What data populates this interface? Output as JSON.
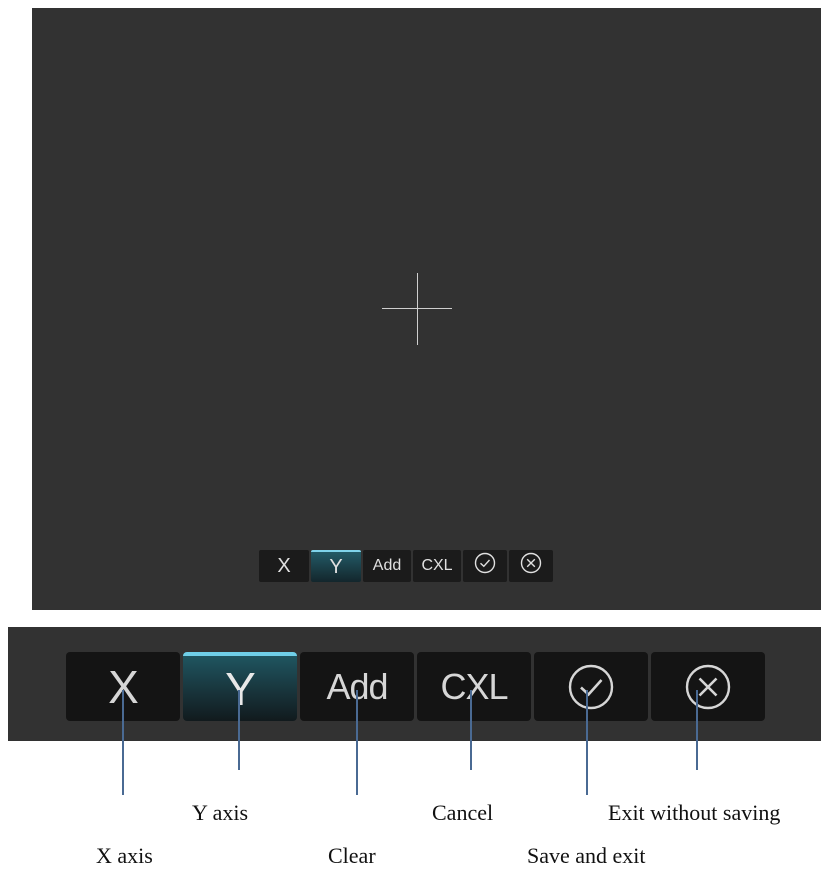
{
  "screen": {
    "toolbar": {
      "x_label": "X",
      "y_label": "Y",
      "add_label": "Add",
      "cxl_label": "CXL",
      "confirm_icon": "check-circle-icon",
      "exit_icon": "x-circle-icon",
      "active_button": "Y"
    }
  },
  "zoom_toolbar": {
    "x_label": "X",
    "y_label": "Y",
    "add_label": "Add",
    "cxl_label": "CXL",
    "confirm_icon": "check-circle-icon",
    "exit_icon": "x-circle-icon",
    "active_button": "Y"
  },
  "annotations": {
    "x_axis": "X axis",
    "y_axis": "Y axis",
    "clear": "Clear",
    "cancel": "Cancel",
    "save_and_exit": "Save and exit",
    "exit_without_saving": "Exit without saving"
  },
  "colors": {
    "screen_bg": "#323232",
    "button_bg": "#141414",
    "active_accent": "#6fcfe8",
    "callout_line": "#4a6a93"
  }
}
